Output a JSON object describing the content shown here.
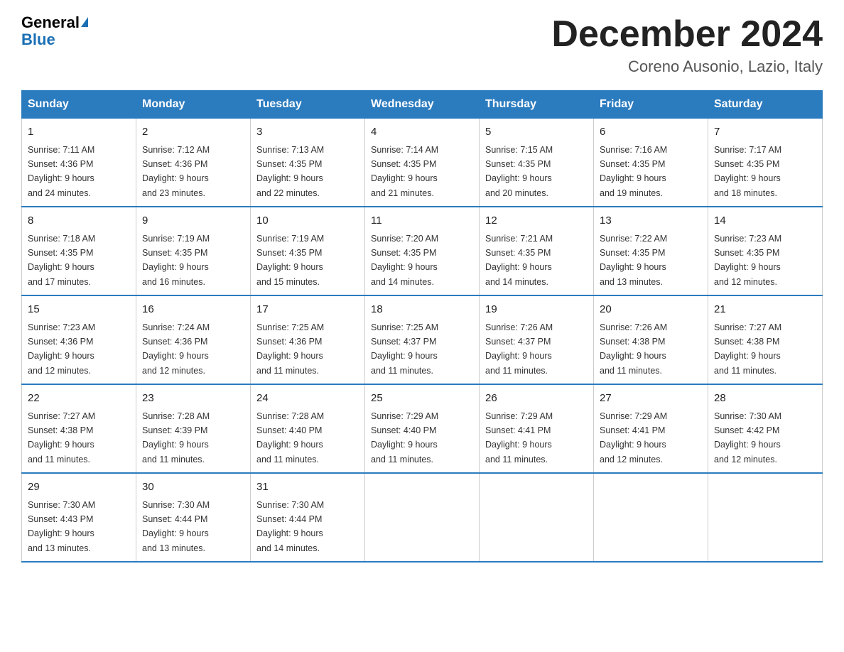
{
  "logo": {
    "general": "General",
    "blue": "Blue"
  },
  "title": "December 2024",
  "location": "Coreno Ausonio, Lazio, Italy",
  "days_of_week": [
    "Sunday",
    "Monday",
    "Tuesday",
    "Wednesday",
    "Thursday",
    "Friday",
    "Saturday"
  ],
  "weeks": [
    [
      {
        "day": "1",
        "sunrise": "7:11 AM",
        "sunset": "4:36 PM",
        "daylight": "9 hours and 24 minutes."
      },
      {
        "day": "2",
        "sunrise": "7:12 AM",
        "sunset": "4:36 PM",
        "daylight": "9 hours and 23 minutes."
      },
      {
        "day": "3",
        "sunrise": "7:13 AM",
        "sunset": "4:35 PM",
        "daylight": "9 hours and 22 minutes."
      },
      {
        "day": "4",
        "sunrise": "7:14 AM",
        "sunset": "4:35 PM",
        "daylight": "9 hours and 21 minutes."
      },
      {
        "day": "5",
        "sunrise": "7:15 AM",
        "sunset": "4:35 PM",
        "daylight": "9 hours and 20 minutes."
      },
      {
        "day": "6",
        "sunrise": "7:16 AM",
        "sunset": "4:35 PM",
        "daylight": "9 hours and 19 minutes."
      },
      {
        "day": "7",
        "sunrise": "7:17 AM",
        "sunset": "4:35 PM",
        "daylight": "9 hours and 18 minutes."
      }
    ],
    [
      {
        "day": "8",
        "sunrise": "7:18 AM",
        "sunset": "4:35 PM",
        "daylight": "9 hours and 17 minutes."
      },
      {
        "day": "9",
        "sunrise": "7:19 AM",
        "sunset": "4:35 PM",
        "daylight": "9 hours and 16 minutes."
      },
      {
        "day": "10",
        "sunrise": "7:19 AM",
        "sunset": "4:35 PM",
        "daylight": "9 hours and 15 minutes."
      },
      {
        "day": "11",
        "sunrise": "7:20 AM",
        "sunset": "4:35 PM",
        "daylight": "9 hours and 14 minutes."
      },
      {
        "day": "12",
        "sunrise": "7:21 AM",
        "sunset": "4:35 PM",
        "daylight": "9 hours and 14 minutes."
      },
      {
        "day": "13",
        "sunrise": "7:22 AM",
        "sunset": "4:35 PM",
        "daylight": "9 hours and 13 minutes."
      },
      {
        "day": "14",
        "sunrise": "7:23 AM",
        "sunset": "4:35 PM",
        "daylight": "9 hours and 12 minutes."
      }
    ],
    [
      {
        "day": "15",
        "sunrise": "7:23 AM",
        "sunset": "4:36 PM",
        "daylight": "9 hours and 12 minutes."
      },
      {
        "day": "16",
        "sunrise": "7:24 AM",
        "sunset": "4:36 PM",
        "daylight": "9 hours and 12 minutes."
      },
      {
        "day": "17",
        "sunrise": "7:25 AM",
        "sunset": "4:36 PM",
        "daylight": "9 hours and 11 minutes."
      },
      {
        "day": "18",
        "sunrise": "7:25 AM",
        "sunset": "4:37 PM",
        "daylight": "9 hours and 11 minutes."
      },
      {
        "day": "19",
        "sunrise": "7:26 AM",
        "sunset": "4:37 PM",
        "daylight": "9 hours and 11 minutes."
      },
      {
        "day": "20",
        "sunrise": "7:26 AM",
        "sunset": "4:38 PM",
        "daylight": "9 hours and 11 minutes."
      },
      {
        "day": "21",
        "sunrise": "7:27 AM",
        "sunset": "4:38 PM",
        "daylight": "9 hours and 11 minutes."
      }
    ],
    [
      {
        "day": "22",
        "sunrise": "7:27 AM",
        "sunset": "4:38 PM",
        "daylight": "9 hours and 11 minutes."
      },
      {
        "day": "23",
        "sunrise": "7:28 AM",
        "sunset": "4:39 PM",
        "daylight": "9 hours and 11 minutes."
      },
      {
        "day": "24",
        "sunrise": "7:28 AM",
        "sunset": "4:40 PM",
        "daylight": "9 hours and 11 minutes."
      },
      {
        "day": "25",
        "sunrise": "7:29 AM",
        "sunset": "4:40 PM",
        "daylight": "9 hours and 11 minutes."
      },
      {
        "day": "26",
        "sunrise": "7:29 AM",
        "sunset": "4:41 PM",
        "daylight": "9 hours and 11 minutes."
      },
      {
        "day": "27",
        "sunrise": "7:29 AM",
        "sunset": "4:41 PM",
        "daylight": "9 hours and 12 minutes."
      },
      {
        "day": "28",
        "sunrise": "7:30 AM",
        "sunset": "4:42 PM",
        "daylight": "9 hours and 12 minutes."
      }
    ],
    [
      {
        "day": "29",
        "sunrise": "7:30 AM",
        "sunset": "4:43 PM",
        "daylight": "9 hours and 13 minutes."
      },
      {
        "day": "30",
        "sunrise": "7:30 AM",
        "sunset": "4:44 PM",
        "daylight": "9 hours and 13 minutes."
      },
      {
        "day": "31",
        "sunrise": "7:30 AM",
        "sunset": "4:44 PM",
        "daylight": "9 hours and 14 minutes."
      },
      null,
      null,
      null,
      null
    ]
  ],
  "labels": {
    "sunrise": "Sunrise:",
    "sunset": "Sunset:",
    "daylight": "Daylight:"
  }
}
